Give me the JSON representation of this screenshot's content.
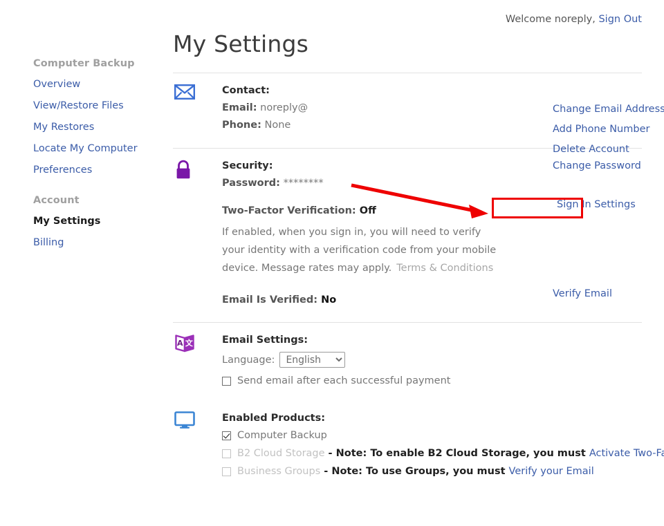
{
  "topbar": {
    "welcome": "Welcome noreply,",
    "sign_out": "Sign Out"
  },
  "sidebar": {
    "group1_title": "Computer Backup",
    "group1_items": [
      {
        "label": "Overview"
      },
      {
        "label": "View/Restore Files"
      },
      {
        "label": "My Restores"
      },
      {
        "label": "Locate My Computer"
      },
      {
        "label": "Preferences"
      }
    ],
    "group2_title": "Account",
    "group2_items": [
      {
        "label": "My Settings"
      },
      {
        "label": "Billing"
      }
    ]
  },
  "page": {
    "title": "My Settings"
  },
  "contact": {
    "icon": "envelope-icon",
    "title": "Contact:",
    "email_label": "Email:",
    "email_value": "noreply@",
    "phone_label": "Phone:",
    "phone_value": "None",
    "links": [
      {
        "label": "Change Email Address"
      },
      {
        "label": "Add Phone Number"
      },
      {
        "label": "Delete Account"
      }
    ]
  },
  "security": {
    "icon": "lock-icon",
    "title": "Security:",
    "password_label": "Password:",
    "password_value": "********",
    "change_password_link": "Change Password",
    "sign_in_settings_link": "Sign In Settings",
    "twofa_label": "Two-Factor Verification:",
    "twofa_value": "Off",
    "twofa_description": "If enabled, when you sign in, you will need to verify your identity with a verification code from your mobile device. Message rates may apply.",
    "terms_link": "Terms & Conditions",
    "verify_email_link": "Verify Email",
    "email_verified_label": "Email Is Verified:",
    "email_verified_value": "No"
  },
  "email_settings": {
    "icon": "language-book-icon",
    "title": "Email Settings:",
    "language_label": "Language:",
    "language_value": "English",
    "language_options": [
      "English"
    ],
    "payment_email_label": "Send email after each successful payment",
    "payment_email_checked": false
  },
  "enabled_products": {
    "icon": "monitor-icon",
    "title": "Enabled Products:",
    "items": [
      {
        "label": "Computer Backup",
        "checked": true,
        "disabled": false,
        "note": "",
        "link": ""
      },
      {
        "label": "B2 Cloud Storage",
        "checked": false,
        "disabled": true,
        "note": "- Note: To enable B2 Cloud Storage, you must",
        "link": "Activate Two-Factor Sign In"
      },
      {
        "label": "Business Groups",
        "checked": false,
        "disabled": true,
        "note": "- Note: To use Groups, you must",
        "link": "Verify your Email"
      }
    ]
  },
  "annotation": {
    "color": "#ee0000",
    "target": "Sign In Settings"
  }
}
